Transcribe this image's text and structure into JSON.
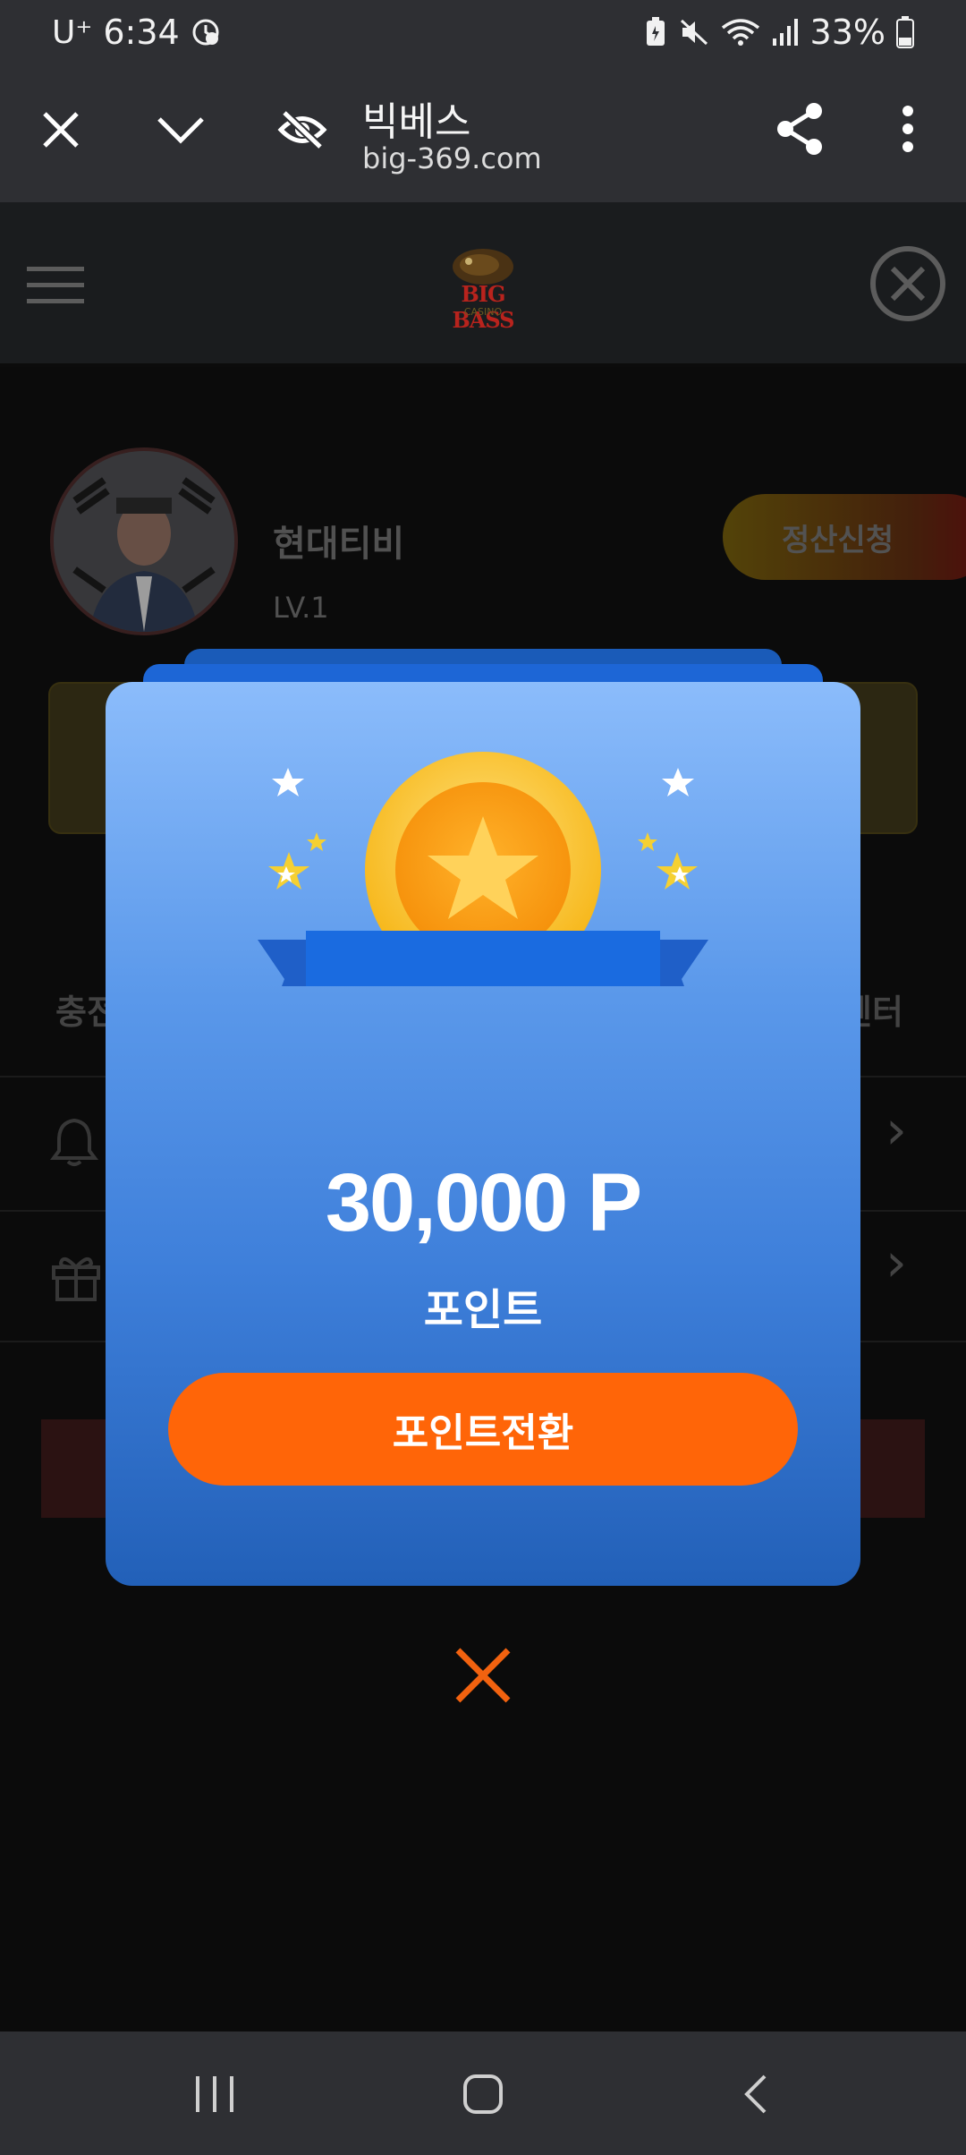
{
  "status_bar": {
    "carrier": "U⁺",
    "time": "6:34",
    "battery": "33%"
  },
  "browser": {
    "site_title": "빅베스",
    "url": "big-369.com"
  },
  "site_header": {
    "logo_text": "BIG BASS",
    "logo_sub": "CASINO"
  },
  "profile": {
    "username": "현대티비",
    "level": "LV.1",
    "settle_button": "정산신청"
  },
  "background_menu": {
    "left_label": "충전",
    "right_label": "센터"
  },
  "popup": {
    "amount": "30,000 P",
    "amount_label": "포인트",
    "convert_button": "포인트전환"
  },
  "colors": {
    "accent_orange": "#ff6508",
    "popup_blue": "#3e7fda"
  }
}
